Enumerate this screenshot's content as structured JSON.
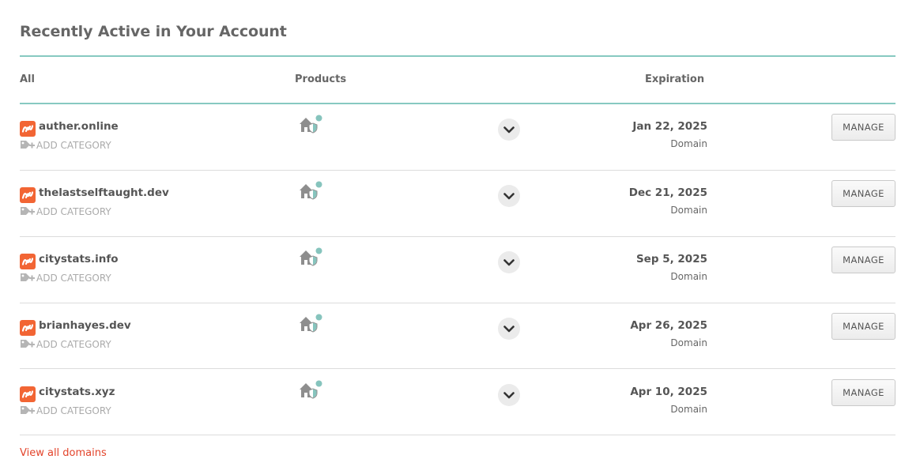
{
  "page": {
    "title": "Recently Active in Your Account",
    "view_all_label": "View all domains"
  },
  "table": {
    "headers": {
      "all": "All",
      "products": "Products",
      "expiration": "Expiration"
    },
    "add_category_label": "ADD CATEGORY",
    "manage_label": "MANAGE",
    "rows": [
      {
        "domain": "auther.online",
        "expiration": "Jan 22, 2025",
        "type": "Domain"
      },
      {
        "domain": "thelastselftaught.dev",
        "expiration": "Dec 21, 2025",
        "type": "Domain"
      },
      {
        "domain": "citystats.info",
        "expiration": "Sep 5, 2025",
        "type": "Domain"
      },
      {
        "domain": "brianhayes.dev",
        "expiration": "Apr 26, 2025",
        "type": "Domain"
      },
      {
        "domain": "citystats.xyz",
        "expiration": "Apr 10, 2025",
        "type": "Domain"
      }
    ]
  },
  "icons": {
    "brand": "namecheap-logo-icon",
    "add_category": "tag-plus-icon",
    "products": "house-shield-icon",
    "expand": "chevron-down-icon"
  },
  "colors": {
    "accent_teal": "#87c9c1",
    "brand_orange": "#f26534",
    "link_red": "#e3442b"
  }
}
